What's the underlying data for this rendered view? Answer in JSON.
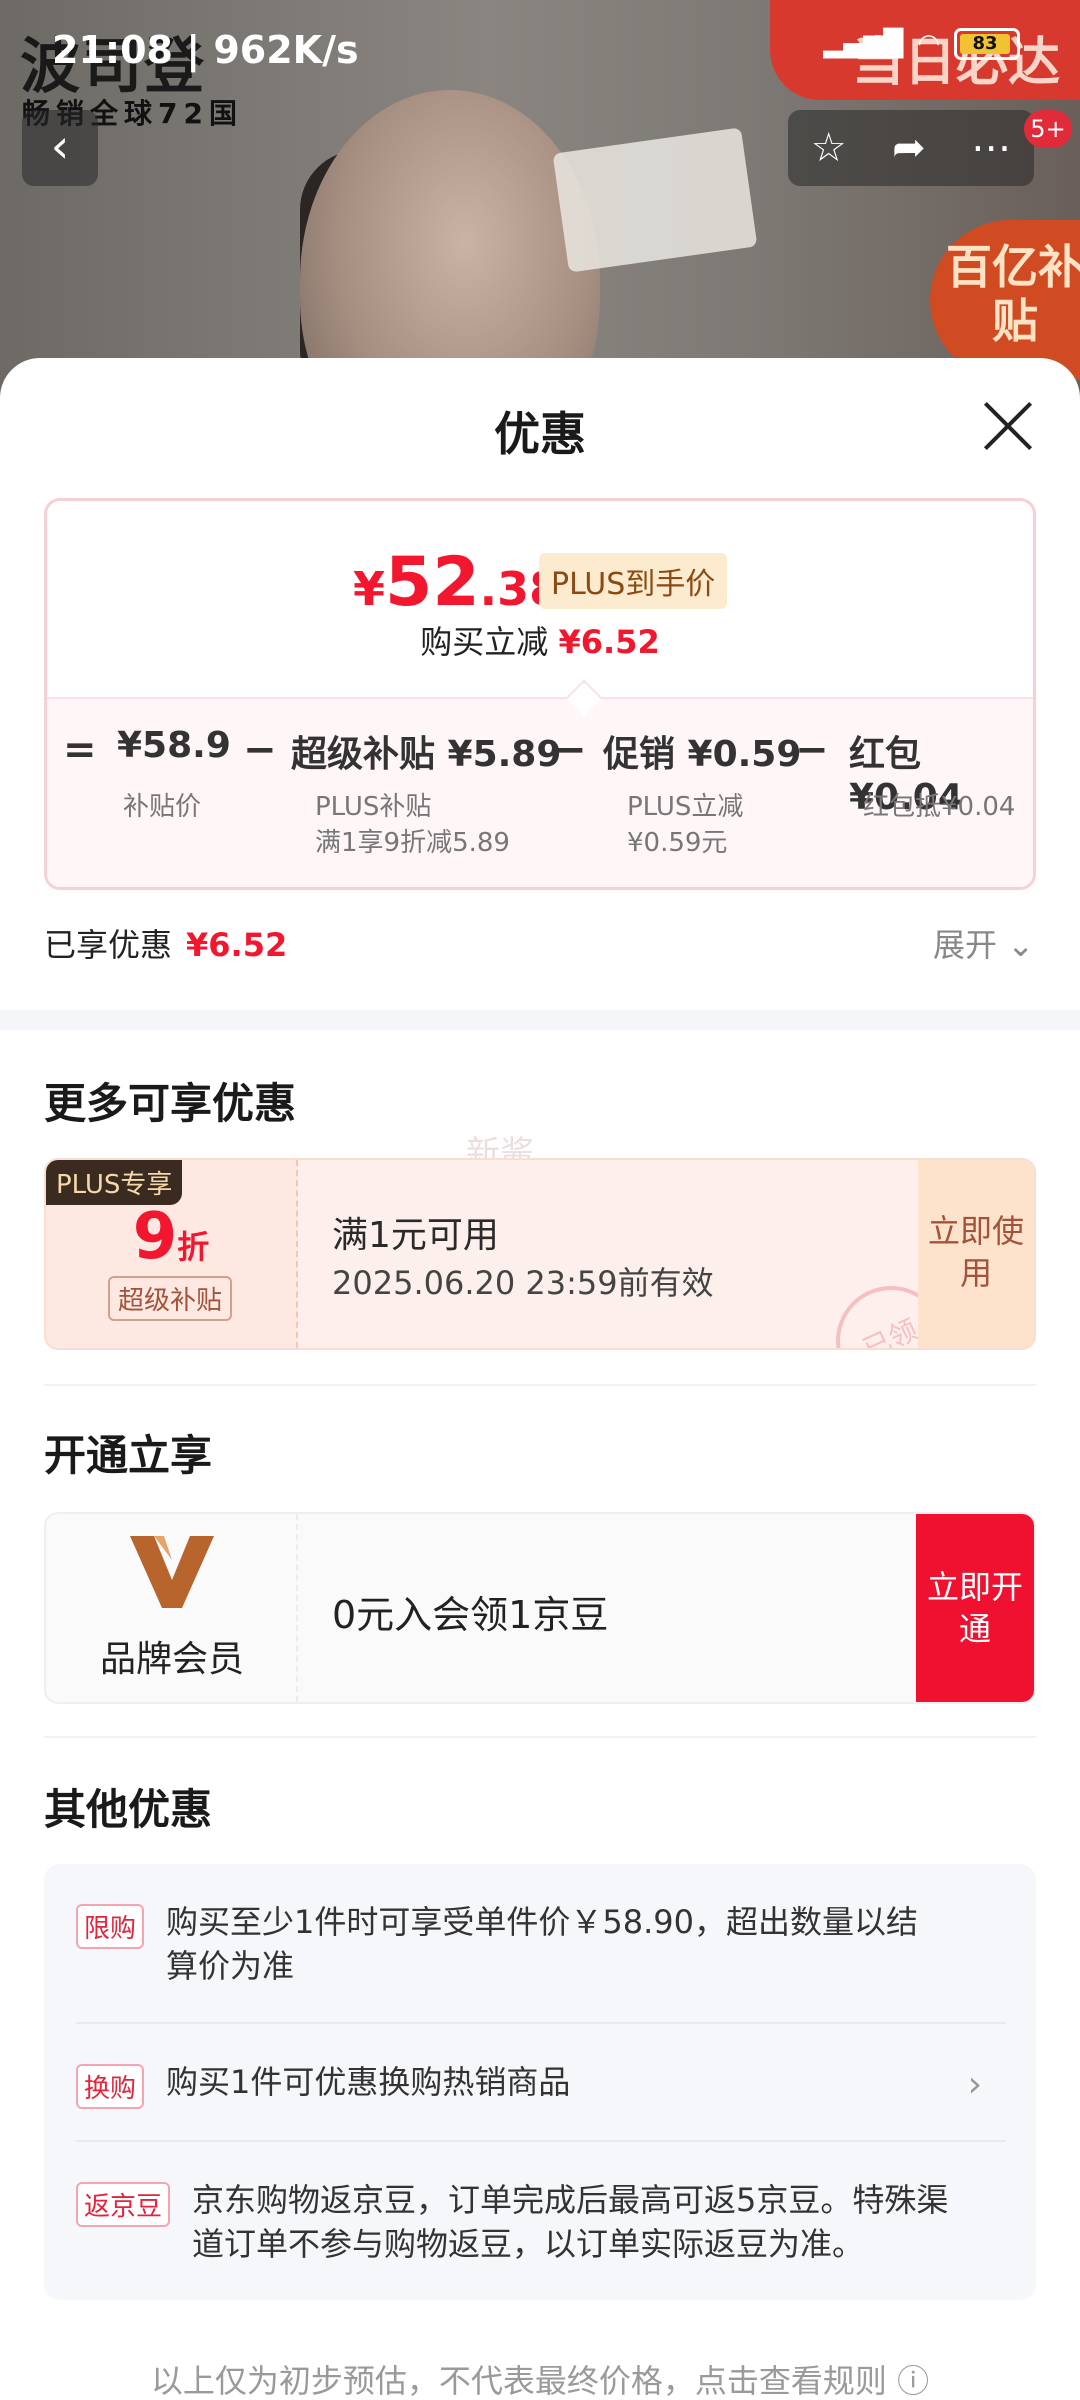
{
  "status_bar": {
    "time": "21:08",
    "speed": "962K/s",
    "battery": "83"
  },
  "background": {
    "brand_text": "波司登",
    "brand_sub": "畅销全球72国",
    "red_tag_text": "当日必达",
    "badge_text": "百亿补贴",
    "notification_count": "5+"
  },
  "sheet": {
    "title": "优惠"
  },
  "price_card": {
    "currency": "¥",
    "price_int": "52",
    "price_dec": ".38",
    "plus_label": "PLUS到手价",
    "instant_cut_label": "购买立减",
    "instant_cut_value": "¥6.52",
    "breakdown": {
      "eq": "=",
      "base_value": "¥58.9",
      "base_label": "补贴价",
      "op1": "−",
      "super_label": "超级补贴 ¥5.89",
      "super_sub1": "PLUS补贴",
      "super_sub2": "满1享9折减5.89",
      "op2": "−",
      "promo_label": "促销 ¥0.59",
      "promo_sub1": "PLUS立减",
      "promo_sub2": "¥0.59元",
      "op3": "−",
      "hb_label": "红包 ¥0.04",
      "hb_sub": "红包抵¥0.04"
    }
  },
  "enjoyed": {
    "label": "已享优惠",
    "value": "¥6.52",
    "expand": "展开"
  },
  "more_offers": {
    "title": "更多可享优惠",
    "watermark": "新酱",
    "coupon": {
      "badge": "PLUS专享",
      "discount": "9",
      "discount_unit": "折",
      "type": "超级补贴",
      "condition": "满1元可用",
      "validity": "2025.06.20 23:59前有效",
      "button": "立即使用",
      "stamp": "已领"
    }
  },
  "open_enjoy": {
    "title": "开通立享",
    "member_name": "品牌会员",
    "offer": "0元入会领1京豆",
    "button": "立即开通"
  },
  "other_offers": {
    "title": "其他优惠",
    "items": [
      {
        "tag": "限购",
        "text": "购买至少1件时可享受单件价￥58.90，超出数量以结算价为准"
      },
      {
        "tag": "换购",
        "text": "购买1件可优惠换购热销商品"
      },
      {
        "tag": "返京豆",
        "text": "京东购物返京豆，订单完成后最高可返5京豆。特殊渠道订单不参与购物返豆，以订单实际返豆为准。"
      }
    ]
  },
  "footer": {
    "note": "以上仅为初步预估，不代表最终价格，点击查看规则"
  },
  "colors": {
    "accent_red": "#f2172f",
    "plus_gold": "#8a4a12"
  }
}
